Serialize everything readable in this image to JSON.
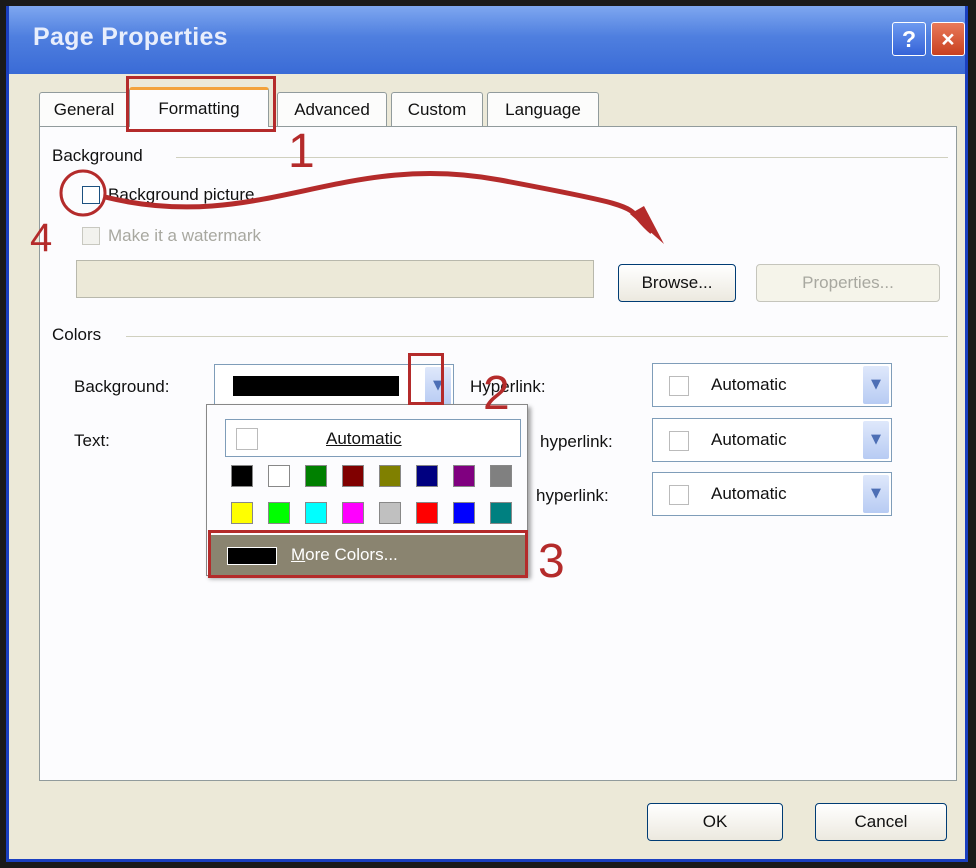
{
  "window": {
    "title": "Page Properties",
    "help_label": "?",
    "close_label": "×"
  },
  "tabs": [
    {
      "label": "General"
    },
    {
      "label": "Formatting"
    },
    {
      "label": "Advanced"
    },
    {
      "label": "Custom"
    },
    {
      "label": "Language"
    }
  ],
  "background_section": {
    "heading": "Background",
    "picture_label": "Background picture",
    "picture_checked": false,
    "watermark_label": "Make it a watermark",
    "watermark_checked": false,
    "path_value": "",
    "browse_label": "Browse...",
    "properties_label": "Properties..."
  },
  "colors_section": {
    "heading": "Colors",
    "background_label": "Background:",
    "background_color": "#000000",
    "text_label": "Text:",
    "hyperlink_label": "Hyperlink:",
    "hyperlink_value": "Automatic",
    "visited_label": "hyperlink:",
    "visited_value": "Automatic",
    "active_label": "hyperlink:",
    "active_value": "Automatic"
  },
  "color_popup": {
    "automatic_label": "Automatic",
    "row1": [
      "#000000",
      "#ffffff",
      "#008000",
      "#800000",
      "#808000",
      "#000080",
      "#800080",
      "#808080"
    ],
    "row2": [
      "#ffff00",
      "#00ff00",
      "#00ffff",
      "#ff00ff",
      "#c0c0c0",
      "#ff0000",
      "#0000ff",
      "#008080"
    ],
    "more_colors_label": "More Colors..."
  },
  "footer": {
    "ok_label": "OK",
    "cancel_label": "Cancel"
  },
  "annotations": {
    "step1": "1",
    "step2": "2",
    "step3": "3",
    "step4": "4",
    "color": "#b42b2b"
  }
}
